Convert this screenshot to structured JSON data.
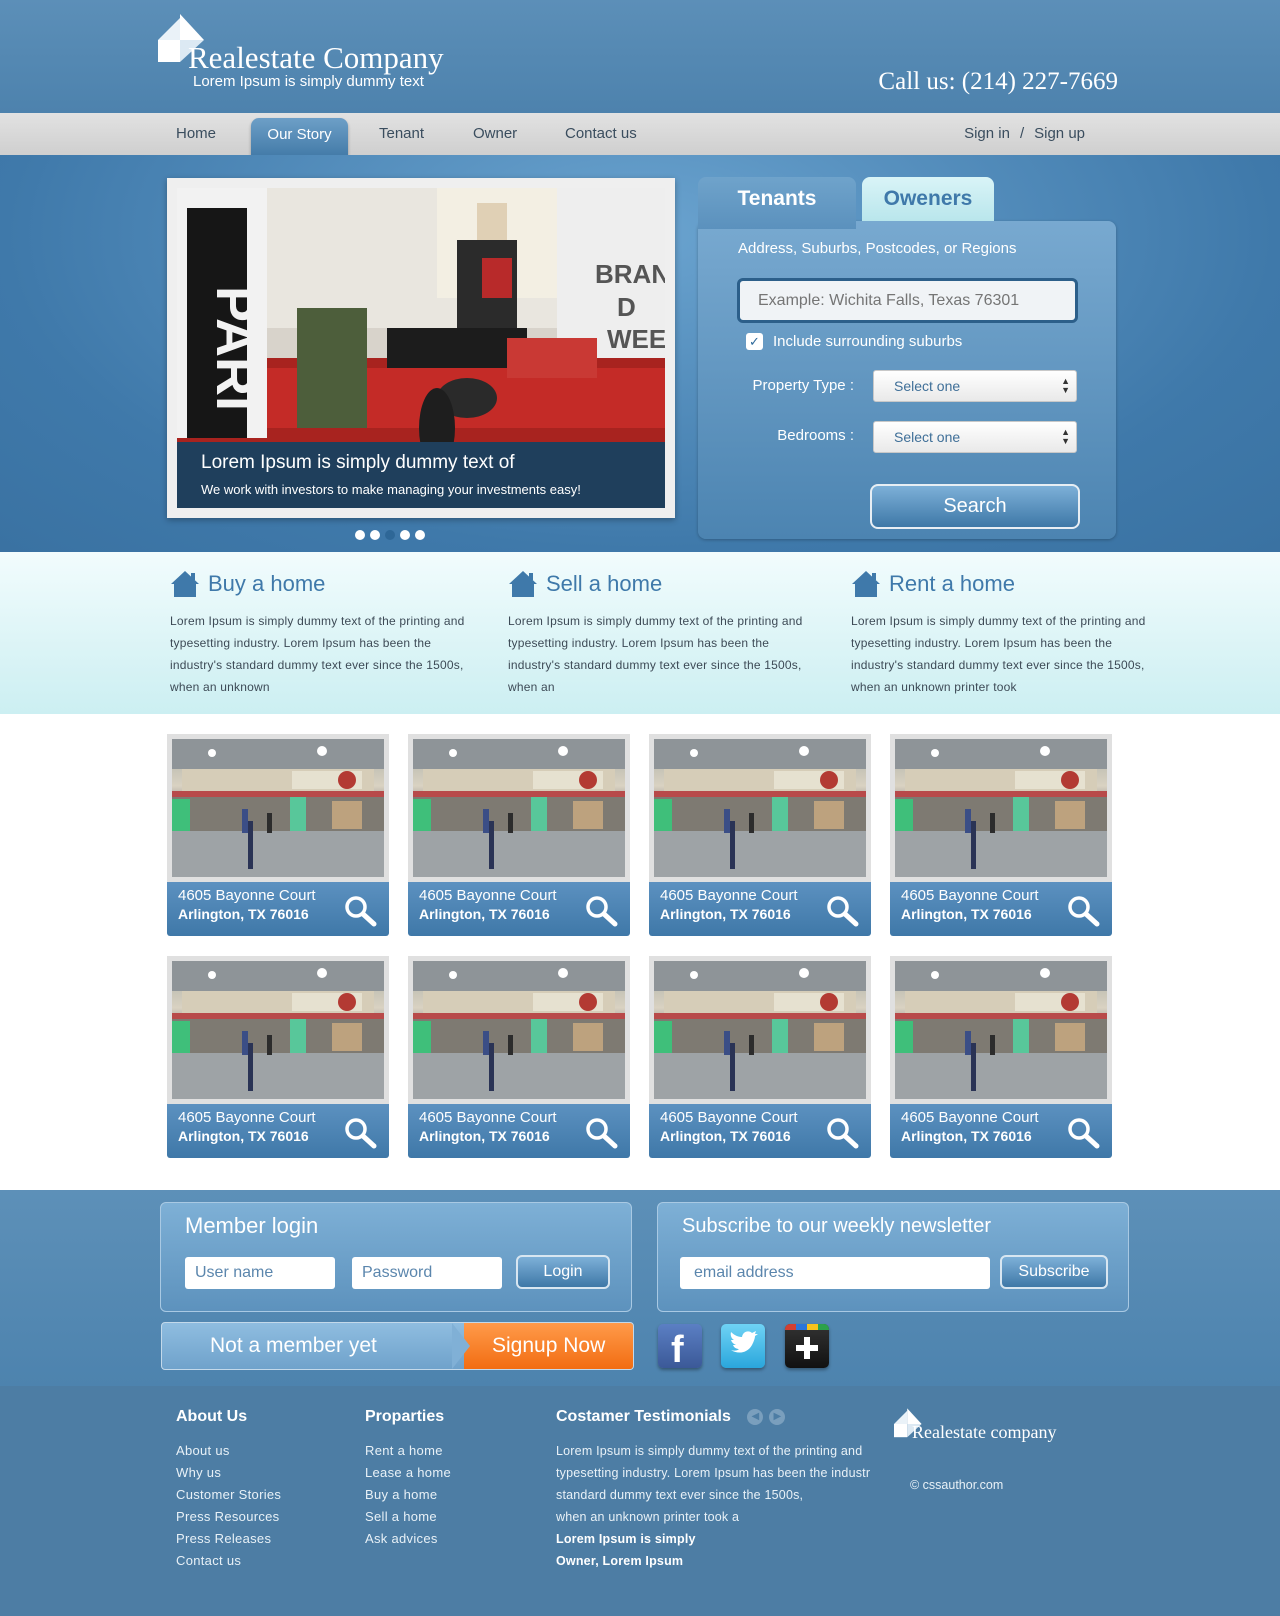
{
  "header": {
    "company_name": "Realestate Company",
    "tagline": "Lorem Ipsum is simply dummy text",
    "call_us": "Call us: (214) 227-7669"
  },
  "nav": {
    "items": [
      "Home",
      "Our Story",
      "Tenant",
      "Owner",
      "Contact us"
    ],
    "active": "Our Story",
    "sign_in": "Sign in",
    "separator": "/",
    "sign_up": "Sign up"
  },
  "slider": {
    "caption_title": "Lorem Ipsum is simply dummy text of",
    "caption_text": "We work with investors to make managing your investments easy!",
    "slide_count": 5,
    "active_slide": 3
  },
  "search": {
    "tabs": [
      "Tenants",
      "Oweners"
    ],
    "active_tab": "Tenants",
    "location_label": "Address, Suburbs, Postcodes, or Regions",
    "location_placeholder": "Example: Wichita Falls, Texas 76301",
    "include_label": "Include surrounding suburbs",
    "include_checked": true,
    "property_type_label": "Property Type :",
    "property_type_value": "Select one",
    "bedrooms_label": "Bedrooms :",
    "bedrooms_value": "Select one",
    "button": "Search"
  },
  "services": [
    {
      "title": "Buy a home",
      "text": "Lorem Ipsum is simply dummy text of the printing and typesetting industry. Lorem Ipsum has been the industry's standard dummy text ever since the 1500s, when an unknown"
    },
    {
      "title": "Sell a home",
      "text": "Lorem Ipsum is simply dummy text of the printing and typesetting industry. Lorem Ipsum has been the industry's standard dummy text ever since the 1500s, when an"
    },
    {
      "title": "Rent a home",
      "text": "Lorem Ipsum is simply dummy text of the printing and typesetting industry. Lorem Ipsum has been the industry's standard dummy text ever since the 1500s, when an unknown printer took"
    }
  ],
  "listings": [
    {
      "address": "4605 Bayonne Court",
      "city": "Arlington, TX 76016"
    },
    {
      "address": "4605 Bayonne Court",
      "city": "Arlington, TX 76016"
    },
    {
      "address": "4605 Bayonne Court",
      "city": "Arlington, TX 76016"
    },
    {
      "address": "4605 Bayonne Court",
      "city": "Arlington, TX 76016"
    },
    {
      "address": "4605 Bayonne Court",
      "city": "Arlington, TX 76016"
    },
    {
      "address": "4605 Bayonne Court",
      "city": "Arlington, TX 76016"
    },
    {
      "address": "4605 Bayonne Court",
      "city": "Arlington, TX 76016"
    },
    {
      "address": "4605 Bayonne Court",
      "city": "Arlington, TX 76016"
    }
  ],
  "member_login": {
    "title": "Member login",
    "username_placeholder": "User name",
    "password_placeholder": "Password",
    "button": "Login"
  },
  "newsletter": {
    "title": "Subscribe to our weekly newsletter",
    "email_placeholder": "email address",
    "button": "Subscribe"
  },
  "signup_banner": {
    "text": "Not a member yet",
    "button": "Signup Now"
  },
  "social": [
    "facebook-icon",
    "twitter-icon",
    "google-plus-icon"
  ],
  "footer": {
    "about": {
      "title": "About Us",
      "links": [
        "About us",
        "Why us",
        "Customer Stories",
        "Press Resources",
        "Press Releases",
        "Contact us"
      ]
    },
    "properties": {
      "title": "Proparties",
      "links": [
        "Rent a home",
        "Lease a home",
        "Buy a home",
        "Sell a home",
        "Ask advices"
      ]
    },
    "testimonials": {
      "title": "Costamer Testimonials",
      "lines": [
        "Lorem Ipsum is simply dummy text of the printing and",
        "typesetting industry. Lorem Ipsum has been the industr",
        "standard dummy text ever since the 1500s,",
        "when an unknown printer took a"
      ],
      "author": "Lorem Ipsum is simply",
      "role": "Owner, Lorem Ipsum"
    },
    "logo_name": "Realestate company",
    "copyright": "© cssauthor.com"
  },
  "colors": {
    "brand_blue": "#4b7ea7",
    "accent_orange": "#f26d12",
    "light_cyan": "#dbf4f6"
  }
}
